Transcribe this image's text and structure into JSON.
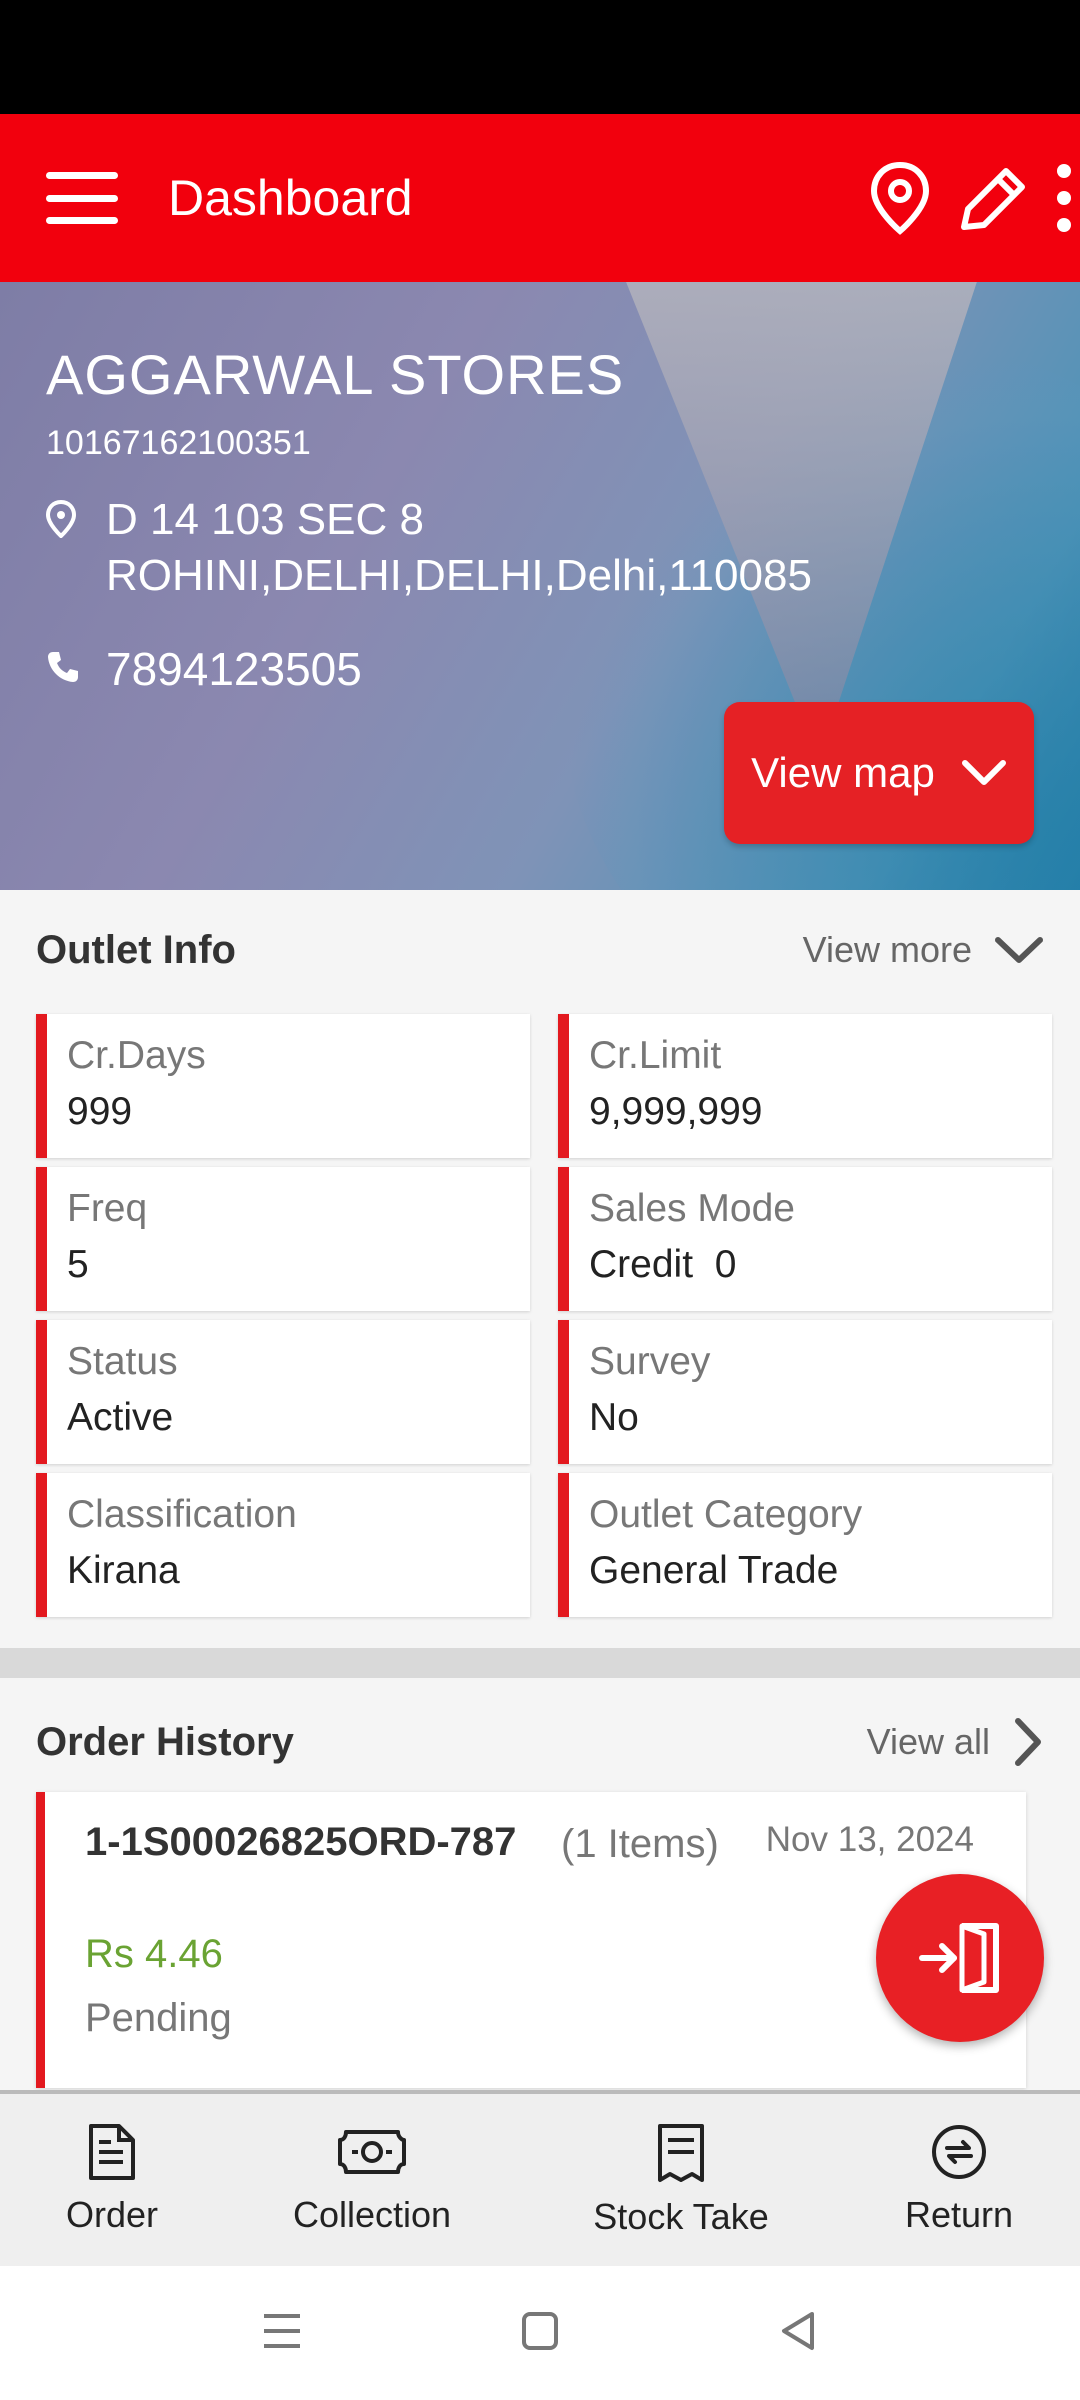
{
  "app_bar": {
    "title": "Dashboard",
    "menu_icon": "hamburger-menu-icon",
    "actions": [
      "location-pin-icon",
      "edit-pencil-icon",
      "more-vertical-icon"
    ],
    "color": "#f2000d"
  },
  "store": {
    "name": "AGGARWAL STORES",
    "code": "10167162100351",
    "address_line1": "D 14 103 SEC 8",
    "address_line2": "ROHINI,DELHI,DELHI,Delhi,110085",
    "phone": "7894123505",
    "view_map_label": "View map"
  },
  "outlet_info": {
    "title": "Outlet Info",
    "view_more_label": "View more",
    "fields": [
      {
        "label": "Cr.Days",
        "value": "999"
      },
      {
        "label": "Cr.Limit",
        "value": "9,999,999"
      },
      {
        "label": "Freq",
        "value": "5"
      },
      {
        "label": "Sales Mode",
        "value": "Credit  0"
      },
      {
        "label": "Status",
        "value": "Active"
      },
      {
        "label": "Survey",
        "value": "No"
      },
      {
        "label": "Classification",
        "value": "Kirana"
      },
      {
        "label": "Outlet Category",
        "value": "General Trade"
      }
    ]
  },
  "order_history": {
    "title": "Order History",
    "view_all_label": "View all",
    "orders": [
      {
        "id": "1-1S00026825ORD-787",
        "items": "(1 Items)",
        "date": "Nov 13, 2024",
        "amount": "Rs 4.46",
        "status": "Pending"
      }
    ]
  },
  "bottom_nav": [
    {
      "label": "Order",
      "icon": "document-icon"
    },
    {
      "label": "Collection",
      "icon": "cash-icon"
    },
    {
      "label": "Stock Take",
      "icon": "receipt-icon"
    },
    {
      "label": "Return",
      "icon": "return-exchange-icon"
    }
  ],
  "colors": {
    "accent_red": "#e3191f",
    "amount_green": "#6aa333"
  }
}
